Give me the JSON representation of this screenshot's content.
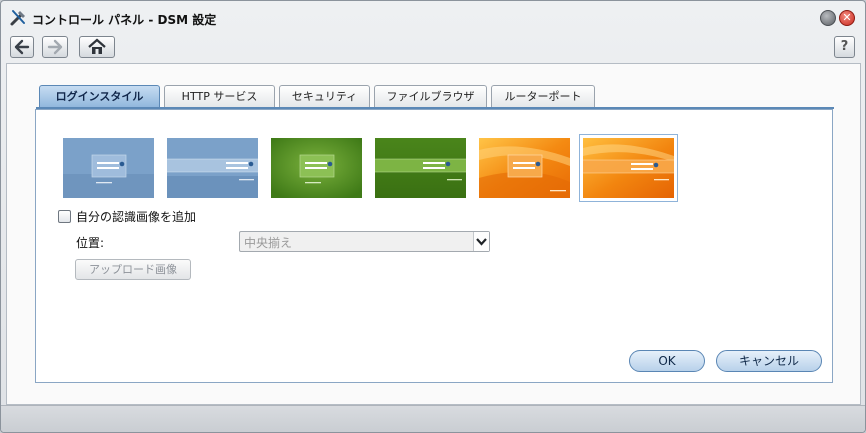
{
  "window": {
    "title": "コントロール パネル - DSM 設定",
    "app_icon": "tools-icon",
    "minimize_icon": "minimize-icon",
    "close_icon": "close-icon"
  },
  "toolbar": {
    "back_icon": "arrow-left-icon",
    "forward_icon": "arrow-right-icon",
    "home_icon": "home-icon",
    "help_label": "?"
  },
  "tabs": [
    {
      "label": "ログインスタイル",
      "active": true
    },
    {
      "label": "HTTP サービス",
      "active": false
    },
    {
      "label": "セキュリティ",
      "active": false
    },
    {
      "label": "ファイルブラウザ",
      "active": false
    },
    {
      "label": "ルーターポート",
      "active": false
    }
  ],
  "login_styles": [
    {
      "theme": "blue",
      "layout": "box",
      "selected": false
    },
    {
      "theme": "blue",
      "layout": "band",
      "selected": false
    },
    {
      "theme": "green",
      "layout": "box",
      "selected": false
    },
    {
      "theme": "green",
      "layout": "band",
      "selected": false
    },
    {
      "theme": "orange",
      "layout": "box",
      "selected": false
    },
    {
      "theme": "orange",
      "layout": "band",
      "selected": true
    }
  ],
  "theme_colors": {
    "blue": "#7ba1c9",
    "green": "#4e8a1f",
    "orange": "#f08c12",
    "accent": "#5b88b6"
  },
  "custom_image": {
    "checkbox_label": "自分の認識画像を追加",
    "checked": false,
    "position_label": "位置:",
    "position_value": "中央揃え",
    "upload_label": "アップロード画像"
  },
  "footer": {
    "ok_label": "OK",
    "cancel_label": "キャンセル"
  }
}
